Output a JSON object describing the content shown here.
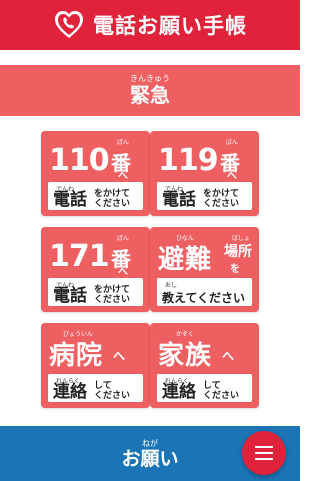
{
  "app": {
    "title": "電話お願い手帳",
    "colors": {
      "header": "#e0223a",
      "card": "#ee5f62",
      "bottom_bar": "#1a74b6",
      "fab": "#e0223a"
    }
  },
  "section": {
    "ruby": "きんきゅう",
    "label": "緊急"
  },
  "cards": [
    {
      "number": "110",
      "ban": "番",
      "ban_ruby": "ばん",
      "he": "へ",
      "panel": {
        "ruby": "でんわ",
        "main": "電話",
        "tail1": "をかけて",
        "tail2": "ください"
      }
    },
    {
      "number": "119",
      "ban": "番",
      "ban_ruby": "ばん",
      "he": "へ",
      "panel": {
        "ruby": "でんわ",
        "main": "電話",
        "tail1": "をかけて",
        "tail2": "ください"
      }
    },
    {
      "number": "171",
      "ban": "番",
      "ban_ruby": "ばん",
      "he": "へ",
      "panel": {
        "ruby": "でんわ",
        "main": "電話",
        "tail1": "をかけて",
        "tail2": "ください"
      }
    },
    {
      "big": "避難",
      "big_ruby": "ひなん",
      "sub": "場所",
      "sub_ruby": "ばしょ",
      "wo": "を",
      "panel": {
        "ruby": "おし",
        "main": "教えてください"
      }
    },
    {
      "big": "病院",
      "big_ruby": "びょういん",
      "he": "へ",
      "panel": {
        "ruby": "れんらく",
        "main": "連絡",
        "tail1": "して",
        "tail2": "ください"
      }
    },
    {
      "big": "家族",
      "big_ruby": "かぞく",
      "he": "へ",
      "panel": {
        "ruby": "れんらく",
        "main": "連絡",
        "tail1": "して",
        "tail2": "ください"
      }
    }
  ],
  "bottom": {
    "ruby": "ねが",
    "label": "お願い"
  },
  "icons": {
    "logo": "heart-phone-icon",
    "menu": "menu-icon"
  }
}
